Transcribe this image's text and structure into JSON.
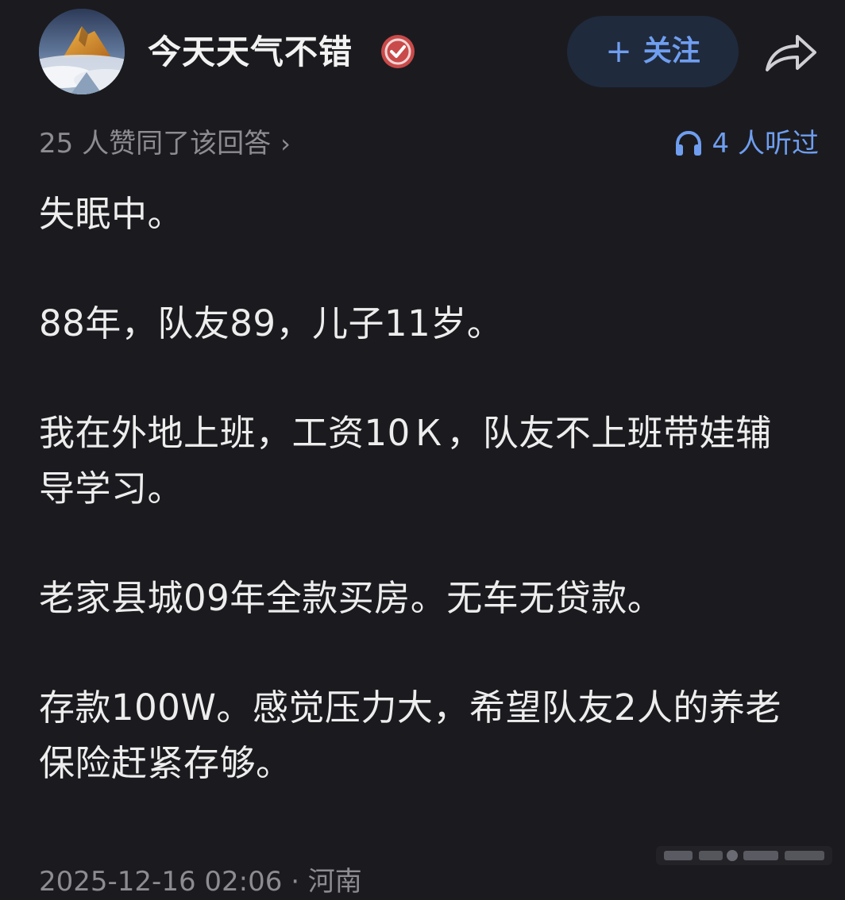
{
  "header": {
    "username": "今天天气不错",
    "follow_plus": "+",
    "follow_label": "关注"
  },
  "meta": {
    "upvote_text": "25 人赞同了该回答",
    "upvote_chevron": "›",
    "listen_text": "4 人听过"
  },
  "answer": {
    "paragraphs": [
      "失眠中。",
      "88年，队友89，儿子11岁。",
      "我在外地上班，工资10Ｋ，队友不上班带娃辅导学习。",
      "老家县城09年全款买房。无车无贷款。",
      "存款100W。感觉压力大，希望队友2人的养老保险赶紧存够。"
    ]
  },
  "footer": {
    "timestamp_location": "2025-12-16 02:06 · 河南"
  },
  "colors": {
    "background": "#1b1b1f",
    "accent": "#6f9ef0",
    "muted": "#8c8c91",
    "verified": "#c94a4a"
  },
  "icons": [
    "avatar-mountain-image",
    "verified-badge-icon",
    "share-icon",
    "headphones-icon",
    "chevron-right-icon"
  ]
}
